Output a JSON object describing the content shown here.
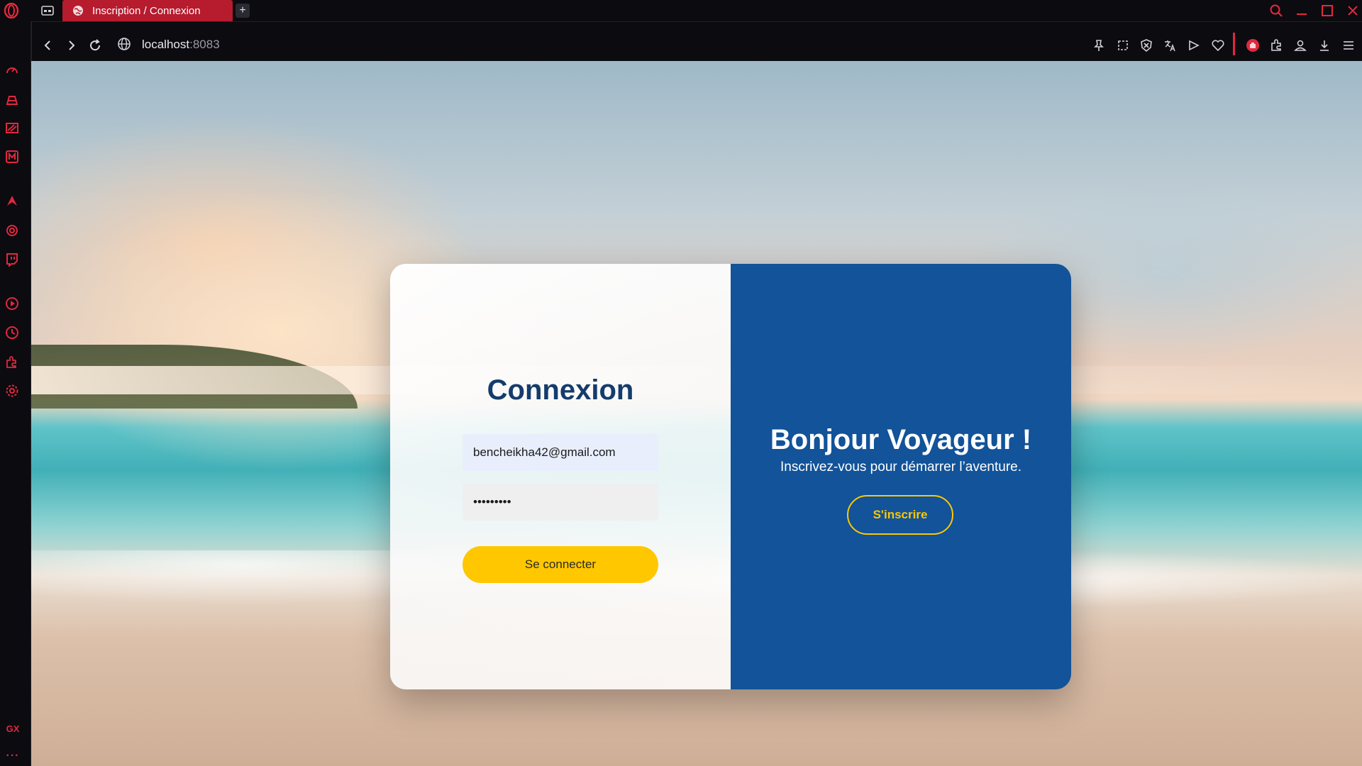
{
  "browser": {
    "tab": {
      "title": "Inscription / Connexion"
    },
    "new_tab_label": "+",
    "address": {
      "host": "localhost",
      "port": ":8083"
    },
    "sidebar": {
      "gx_label": "GX",
      "more_label": "···"
    },
    "accent_color": "#e0283e"
  },
  "login": {
    "title": "Connexion",
    "email_value": "bencheikha42@gmail.com",
    "password_value": "•••••••••",
    "submit_label": "Se connecter"
  },
  "register": {
    "title": "Bonjour Voyageur !",
    "subtitle": "Inscrivez-vous pour démarrer l’aventure.",
    "button_label": "S'inscrire"
  },
  "colors": {
    "primary_blue": "#125399",
    "title_blue": "#143c6c",
    "accent_yellow": "#ffc700",
    "email_bg": "#e8eefc"
  }
}
